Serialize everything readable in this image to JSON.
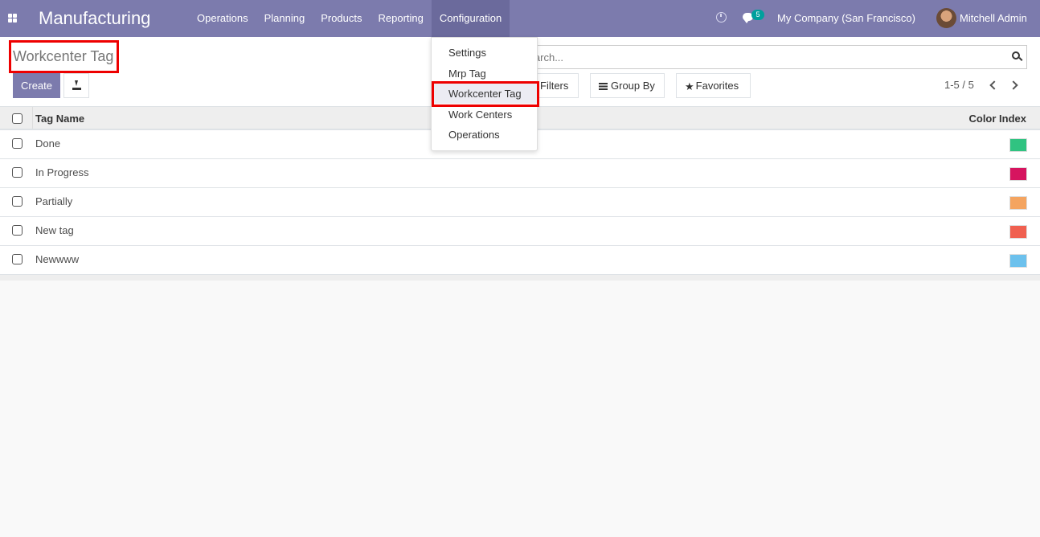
{
  "navbar": {
    "app_name": "Manufacturing",
    "menu": [
      "Operations",
      "Planning",
      "Products",
      "Reporting",
      "Configuration"
    ],
    "open_menu": "Configuration",
    "messages_badge": "5",
    "company": "My Company (San Francisco)",
    "user": "Mitchell Admin",
    "bg_color": "#7c7bad"
  },
  "control_panel": {
    "title": "Workcenter Tag",
    "create_label": "Create",
    "search_placeholder": "Search...",
    "filters_label": "Filters",
    "groupby_label": "Group By",
    "favorites_label": "Favorites",
    "pager": "1-5 / 5"
  },
  "dropdown": {
    "items": [
      "Settings",
      "Mrp Tag",
      "Workcenter Tag",
      "Work Centers",
      "Operations"
    ],
    "active": "Workcenter Tag"
  },
  "table": {
    "headers": {
      "name": "Tag Name",
      "color": "Color Index"
    },
    "rows": [
      {
        "name": "Done",
        "color": "#30c381"
      },
      {
        "name": "In Progress",
        "color": "#d6145f"
      },
      {
        "name": "Partially",
        "color": "#f4a460"
      },
      {
        "name": "New tag",
        "color": "#f06050"
      },
      {
        "name": "Newwww",
        "color": "#6cc1ed"
      }
    ]
  }
}
